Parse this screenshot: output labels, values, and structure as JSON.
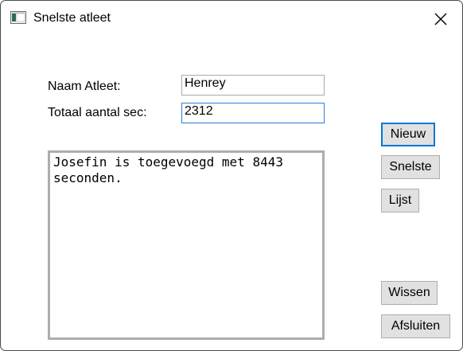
{
  "window": {
    "title": "Snelste atleet"
  },
  "form": {
    "name_label": "Naam Atleet:",
    "name_value": "Henrey",
    "seconds_label": "Totaal aantal sec:",
    "seconds_value": "2312"
  },
  "output": {
    "text": "Josefin is toegevoegd met 8443\nseconden."
  },
  "buttons": {
    "new": "Nieuw",
    "fastest": "Snelste",
    "list": "Lijst",
    "clear": "Wissen",
    "exit": "Afsluiten"
  },
  "icons": {
    "app": "window-app-icon",
    "close": "close-icon"
  },
  "colors": {
    "focus": "#2b7fd6",
    "button_face": "#e1e1e1",
    "default_button_border": "#0078d7"
  }
}
